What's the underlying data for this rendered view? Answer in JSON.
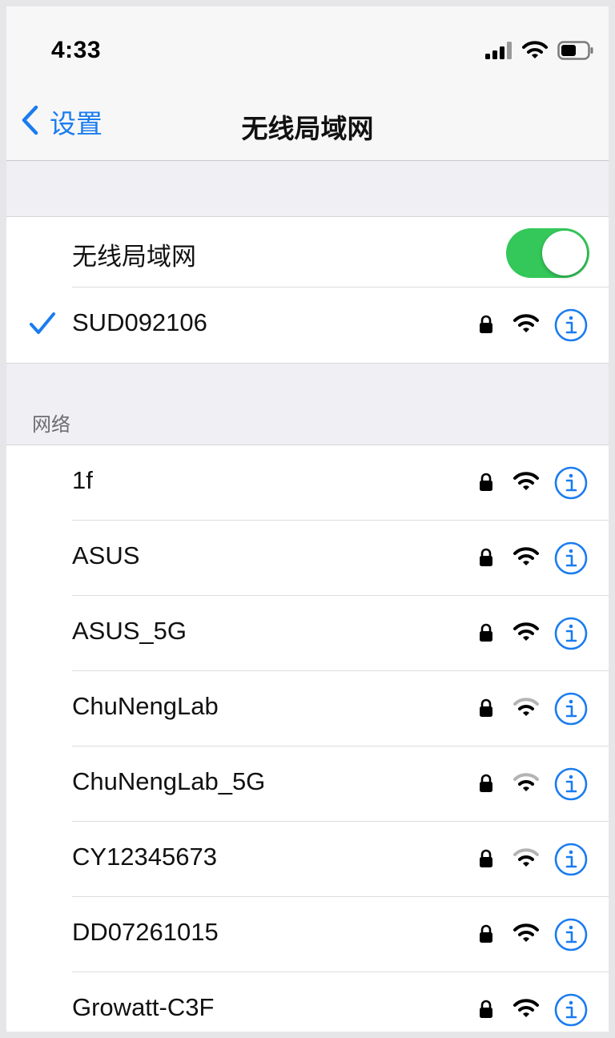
{
  "status_bar": {
    "time": "4:33",
    "icons": [
      "cellular-signal-icon",
      "wifi-icon",
      "battery-icon"
    ]
  },
  "nav": {
    "back_label": "设置",
    "title": "无线局域网",
    "back_icon": "chevron-left-icon"
  },
  "wifi_toggle": {
    "label": "无线局域网",
    "on": true
  },
  "current_network": {
    "name": "SUD092106",
    "connected": true,
    "secured": true,
    "signal": "strong"
  },
  "networks_section": {
    "header": "网络",
    "items": [
      {
        "name": "1f",
        "secured": true,
        "signal": "strong"
      },
      {
        "name": "ASUS",
        "secured": true,
        "signal": "strong"
      },
      {
        "name": "ASUS_5G",
        "secured": true,
        "signal": "strong"
      },
      {
        "name": "ChuNengLab",
        "secured": true,
        "signal": "medium"
      },
      {
        "name": "ChuNengLab_5G",
        "secured": true,
        "signal": "medium"
      },
      {
        "name": "CY12345673",
        "secured": true,
        "signal": "medium"
      },
      {
        "name": "DD07261015",
        "secured": true,
        "signal": "strong"
      },
      {
        "name": "Growatt-C3F",
        "secured": true,
        "signal": "strong"
      }
    ]
  },
  "colors": {
    "accent": "#1a7cf0",
    "toggle_on": "#34c759",
    "grouped_background": "#efeff4"
  }
}
